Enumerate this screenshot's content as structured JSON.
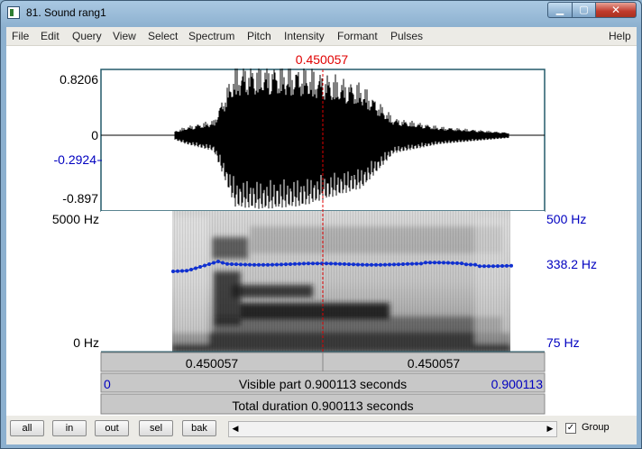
{
  "window": {
    "title": "81. Sound rang1",
    "minimize": "▁",
    "maximize": "▢",
    "close": "✕"
  },
  "menu": [
    "File",
    "Edit",
    "Query",
    "View",
    "Select",
    "Spectrum",
    "Pitch",
    "Intensity",
    "Formant",
    "Pulses",
    "Help"
  ],
  "cursor": {
    "time": "0.450057"
  },
  "waveform": {
    "max_label": "0.8206",
    "zero_label": "0",
    "cursor_value": "-0.2924",
    "min_label": "-0.897"
  },
  "spectrogram": {
    "freq_top": "5000 Hz",
    "freq_bottom": "0 Hz",
    "pitch_top": "500 Hz",
    "pitch_value": "338.2 Hz",
    "pitch_bottom": "75 Hz"
  },
  "time_bar": {
    "left_segment": "0.450057",
    "right_segment": "0.450057",
    "visible_start": "0",
    "visible_label": "Visible part 0.900113 seconds",
    "visible_end": "0.900113",
    "total_label": "Total duration 0.900113 seconds"
  },
  "buttons": {
    "all": "all",
    "in": "in",
    "out": "out",
    "sel": "sel",
    "bak": "bak"
  },
  "scrollbar": {
    "left_arrow": "◀",
    "right_arrow": "▶"
  },
  "group": {
    "label": "Group",
    "checked": "✓"
  },
  "colors": {
    "cursor": "#e00000",
    "pitch": "#1030d0",
    "label_blue": "#0000c0"
  }
}
